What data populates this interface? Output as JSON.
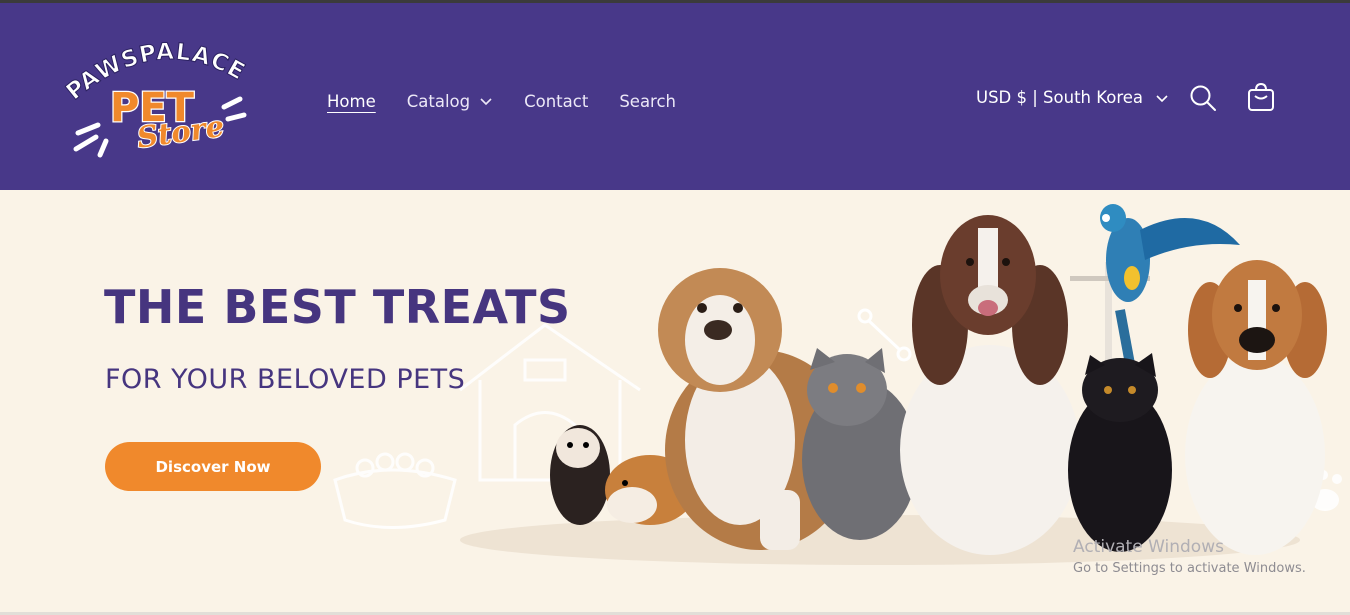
{
  "header": {
    "logo": {
      "line1": "PAWSPALACE",
      "line2": "PET",
      "line3": "Store"
    },
    "nav": [
      {
        "label": "Home",
        "active": true
      },
      {
        "label": "Catalog",
        "has_dropdown": true
      },
      {
        "label": "Contact"
      },
      {
        "label": "Search"
      }
    ],
    "currency_selector": "USD $ | South Korea",
    "icons": [
      "search-icon",
      "cart-icon",
      "chevron-down-icon"
    ]
  },
  "hero": {
    "title": "THE BEST TREATS",
    "subtitle": "FOR YOUR BELOVED PETS",
    "cta_label": "Discover Now"
  },
  "os_watermark": {
    "title": "Activate Windows",
    "message": "Go to Settings to activate Windows."
  },
  "colors": {
    "header_bg": "#483889",
    "hero_bg": "#faf3e7",
    "accent": "#f0892c",
    "title": "#46357f"
  }
}
